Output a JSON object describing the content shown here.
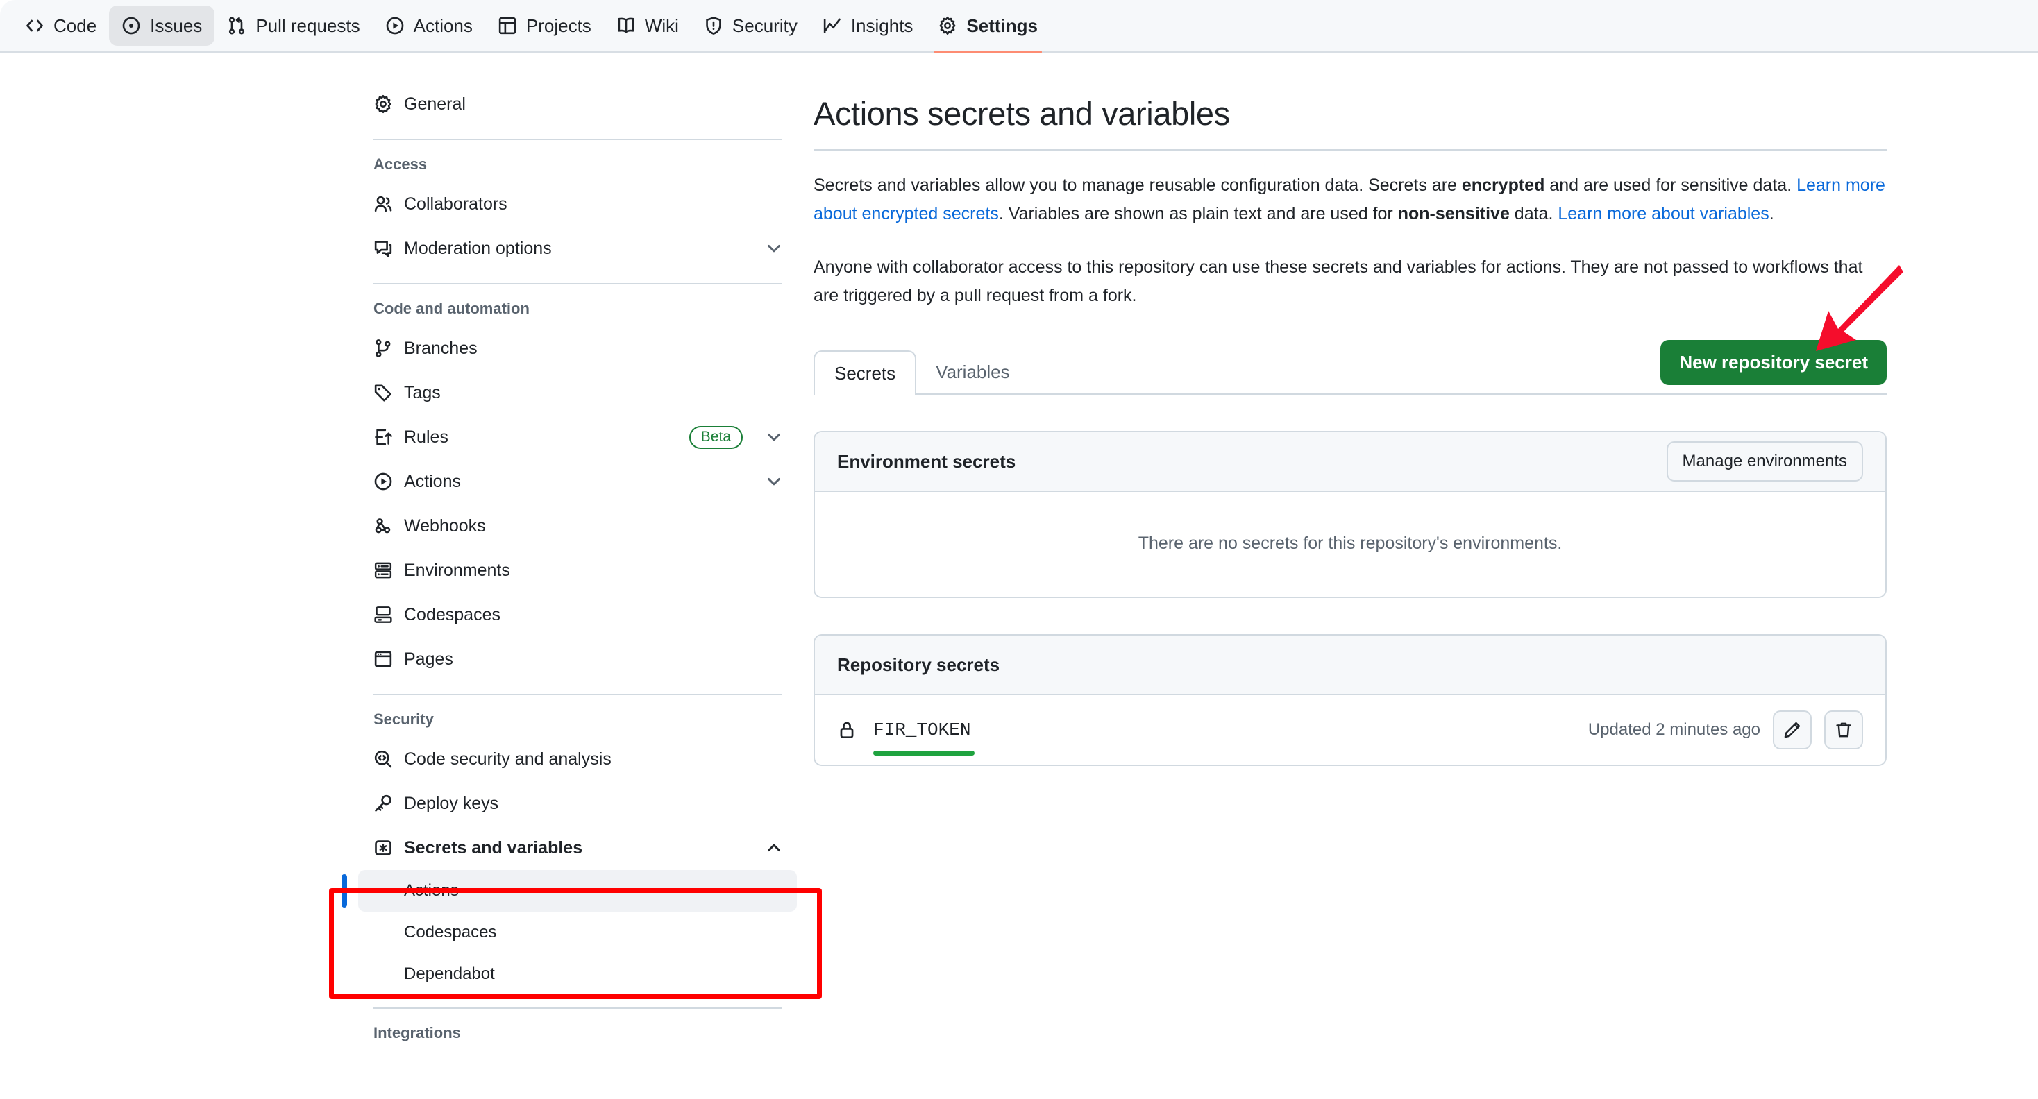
{
  "topnav": {
    "items": [
      {
        "label": "Code",
        "icon": "code-icon",
        "state": "normal"
      },
      {
        "label": "Issues",
        "icon": "issue-opened-icon",
        "state": "hovered"
      },
      {
        "label": "Pull requests",
        "icon": "git-pull-request-icon",
        "state": "normal"
      },
      {
        "label": "Actions",
        "icon": "play-icon",
        "state": "normal"
      },
      {
        "label": "Projects",
        "icon": "table-icon",
        "state": "normal"
      },
      {
        "label": "Wiki",
        "icon": "book-icon",
        "state": "normal"
      },
      {
        "label": "Security",
        "icon": "shield-icon",
        "state": "normal"
      },
      {
        "label": "Insights",
        "icon": "graph-icon",
        "state": "normal"
      },
      {
        "label": "Settings",
        "icon": "gear-icon",
        "state": "active"
      }
    ],
    "active_underline_color": "#fd8c73"
  },
  "sidebar": {
    "general": {
      "label": "General",
      "icon": "gear-icon"
    },
    "sections": [
      {
        "heading": "Access",
        "items": [
          {
            "label": "Collaborators",
            "icon": "people-icon",
            "chevron": ""
          },
          {
            "label": "Moderation options",
            "icon": "comment-icon",
            "chevron": "down"
          }
        ]
      },
      {
        "heading": "Code and automation",
        "items": [
          {
            "label": "Branches",
            "icon": "git-branch-icon",
            "chevron": ""
          },
          {
            "label": "Tags",
            "icon": "tag-icon",
            "chevron": ""
          },
          {
            "label": "Rules",
            "icon": "rules-icon",
            "chevron": "down",
            "badge": "Beta"
          },
          {
            "label": "Actions",
            "icon": "play-icon",
            "chevron": "down"
          },
          {
            "label": "Webhooks",
            "icon": "webhook-icon",
            "chevron": ""
          },
          {
            "label": "Environments",
            "icon": "server-icon",
            "chevron": ""
          },
          {
            "label": "Codespaces",
            "icon": "codespaces-icon",
            "chevron": ""
          },
          {
            "label": "Pages",
            "icon": "browser-icon",
            "chevron": ""
          }
        ]
      },
      {
        "heading": "Security",
        "items": [
          {
            "label": "Code security and analysis",
            "icon": "codescan-icon",
            "chevron": ""
          },
          {
            "label": "Deploy keys",
            "icon": "key-icon",
            "chevron": ""
          }
        ]
      }
    ],
    "secrets_group": {
      "label": "Secrets and variables",
      "icon": "asterisk-key-icon",
      "chevron": "up",
      "sub_items": [
        {
          "label": "Actions",
          "selected": true
        },
        {
          "label": "Codespaces",
          "selected": false
        },
        {
          "label": "Dependabot",
          "selected": false
        }
      ]
    },
    "integrations_heading": "Integrations"
  },
  "main": {
    "title": "Actions secrets and variables",
    "paragraph1": {
      "part1": "Secrets and variables allow you to manage reusable configuration data. Secrets are ",
      "bold1": "encrypted",
      "part2": " and are used for sensitive data. ",
      "link1": "Learn more about encrypted secrets",
      "part3": ". Variables are shown as plain text and are used for ",
      "bold2": "non-sensitive",
      "part4": " data. ",
      "link2": "Learn more about variables",
      "part5": "."
    },
    "paragraph2": "Anyone with collaborator access to this repository can use these secrets and variables for actions. They are not passed to workflows that are triggered by a pull request from a fork.",
    "tabs": [
      {
        "label": "Secrets",
        "active": true
      },
      {
        "label": "Variables",
        "active": false
      }
    ],
    "new_secret_button": "New repository secret",
    "environment_panel": {
      "title": "Environment secrets",
      "manage_button": "Manage environments",
      "empty_text": "There are no secrets for this repository's environments."
    },
    "repository_panel": {
      "title": "Repository secrets",
      "rows": [
        {
          "name": "FIR_TOKEN",
          "icon": "lock-icon",
          "updated": "Updated 2 minutes ago",
          "edit_icon": "pencil-icon",
          "delete_icon": "trash-icon"
        }
      ]
    }
  },
  "annotations": {
    "sidebar_box_color": "#ff0000",
    "arrow_color": "#f50d2c",
    "secret_underline_color": "#1fa33f"
  }
}
